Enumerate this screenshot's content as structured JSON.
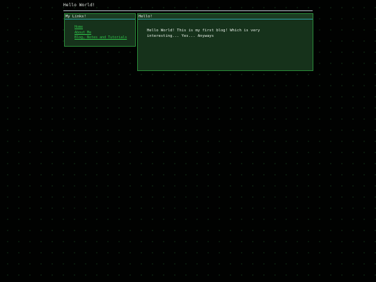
{
  "header": {
    "title": "Hello World!"
  },
  "sidebar": {
    "heading": "My Links!",
    "links": [
      {
        "label": "Home"
      },
      {
        "label": "About Me"
      },
      {
        "label": "Blog, Notes and Tutorials"
      }
    ]
  },
  "main": {
    "heading": "Hello!",
    "body": "Hello World! This is my first blog! Which is very interesting... Yes... Anyways"
  },
  "colors": {
    "background": "#010201",
    "panel": "#16321b",
    "panel_border": "#2a8a38",
    "header_rule": "#2fa3a8",
    "link": "#2fc24a"
  }
}
